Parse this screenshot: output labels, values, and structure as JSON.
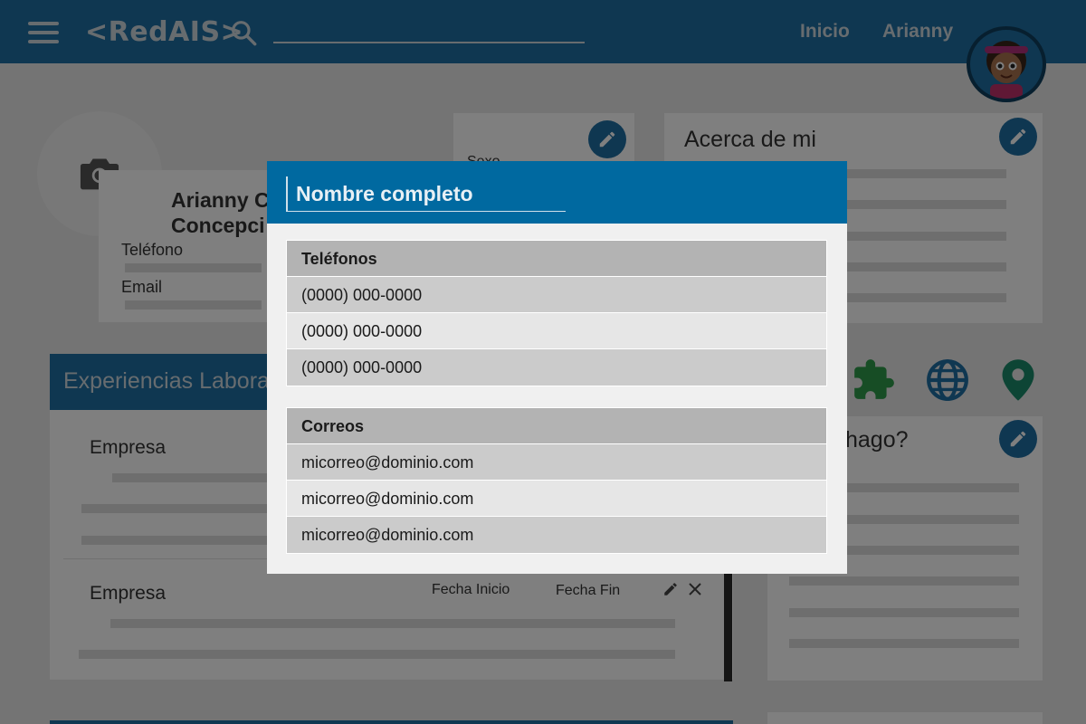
{
  "header": {
    "logo": "<RedAIS>",
    "search_placeholder": "",
    "nav": {
      "inicio": "Inicio",
      "user": "Arianny"
    }
  },
  "profile": {
    "name_line1": "Arianny C",
    "name_line2": "Concepci",
    "phone_label": "Teléfono",
    "email_label": "Email",
    "sexo_label": "Sexo",
    "about_title": "Acerca de mi"
  },
  "experience": {
    "section_title": "Experiencias Labora",
    "items": [
      {
        "company": "Empresa"
      },
      {
        "company": "Empresa",
        "start_label": "Fecha Inicio",
        "end_label": "Fecha Fin"
      }
    ]
  },
  "hobbies": {
    "title_fragment": "hago?"
  },
  "modal": {
    "title": "Nombre completo",
    "phones": {
      "header": "Teléfonos",
      "items": [
        "(0000) 000-0000",
        "(0000) 000-0000",
        "(0000) 000-0000"
      ]
    },
    "emails": {
      "header": "Correos",
      "items": [
        "micorreo@dominio.com",
        "micorreo@dominio.com",
        "micorreo@dominio.com"
      ]
    }
  },
  "colors": {
    "primary": "#1f6fa3",
    "modal_header": "#0069a0",
    "puzzle_icon": "#2e9a4a",
    "globe_icon": "#1f6fa3",
    "pin_icon": "#1a8a6a"
  },
  "icons": {
    "menu": "hamburger-icon",
    "search": "search-icon",
    "camera": "camera-icon",
    "edit": "pencil-icon",
    "close": "close-icon",
    "puzzle": "puzzle-icon",
    "globe": "globe-icon",
    "location": "map-pin-icon"
  }
}
